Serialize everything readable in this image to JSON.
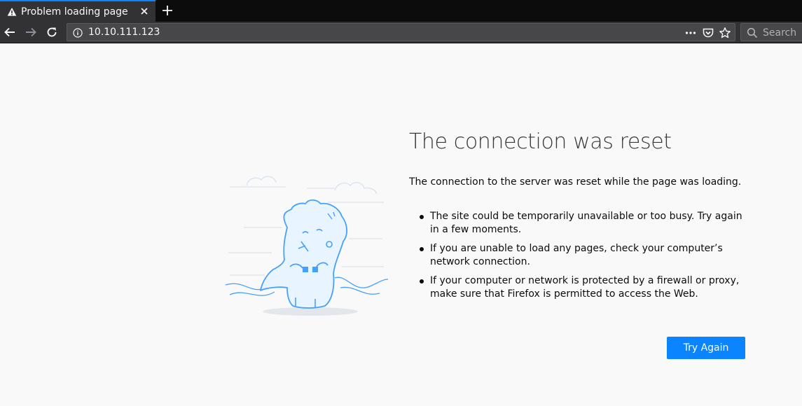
{
  "tab": {
    "title": "Problem loading page"
  },
  "urlbar": {
    "url": "10.10.111.123"
  },
  "searchbar": {
    "placeholder": "Search"
  },
  "error": {
    "title": "The connection was reset",
    "lead": "The connection to the server was reset while the page was loading.",
    "reasons": [
      "The site could be temporarily unavailable or too busy. Try again in a few moments.",
      "If you are unable to load any pages, check your computer’s network connection.",
      "If your computer or network is protected by a firewall or proxy, make sure that Firefox is permitted to access the Web."
    ],
    "try_again_label": "Try Again"
  },
  "colors": {
    "accent": "#0a84ff",
    "toolbar": "#323234",
    "tabstrip": "#0c0c0d",
    "page_bg": "#f9f9fa"
  },
  "icons": [
    "warning-icon",
    "close-icon",
    "plus-icon",
    "back-arrow-icon",
    "forward-arrow-icon",
    "reload-icon",
    "info-icon",
    "more-icon",
    "pocket-icon",
    "bookmark-star-icon",
    "search-icon"
  ]
}
